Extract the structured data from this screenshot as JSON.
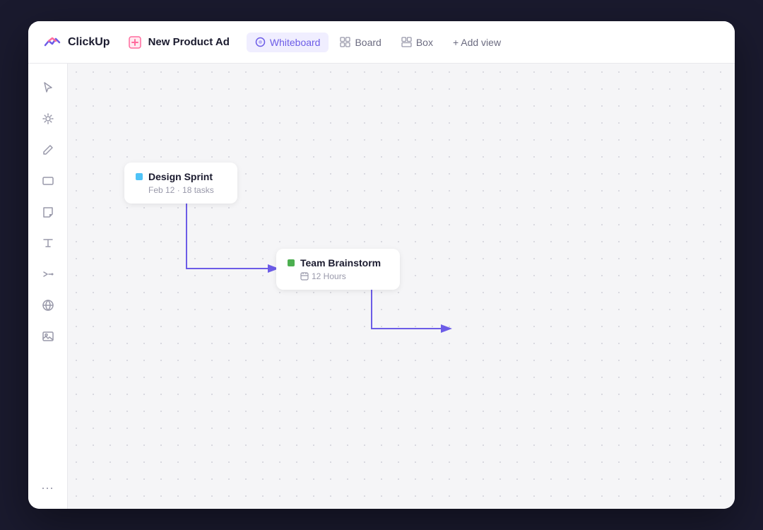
{
  "app": {
    "name": "ClickUp"
  },
  "topbar": {
    "project_title": "New Product Ad",
    "tabs": [
      {
        "id": "whiteboard",
        "label": "Whiteboard",
        "active": true,
        "icon": "⬡"
      },
      {
        "id": "board",
        "label": "Board",
        "active": false,
        "icon": "⊞"
      },
      {
        "id": "box",
        "label": "Box",
        "active": false,
        "icon": "⊟"
      }
    ],
    "add_view_label": "+ Add view"
  },
  "sidebar": {
    "icons": [
      {
        "id": "cursor",
        "name": "cursor-icon"
      },
      {
        "id": "magic",
        "name": "magic-icon"
      },
      {
        "id": "pen",
        "name": "pen-icon"
      },
      {
        "id": "rect",
        "name": "rectangle-icon"
      },
      {
        "id": "note",
        "name": "sticky-note-icon"
      },
      {
        "id": "text",
        "name": "text-icon"
      },
      {
        "id": "connector",
        "name": "connector-icon"
      },
      {
        "id": "globe",
        "name": "globe-icon"
      },
      {
        "id": "image",
        "name": "image-icon"
      }
    ],
    "more_label": "..."
  },
  "canvas": {
    "cards": [
      {
        "id": "design-sprint",
        "title": "Design Sprint",
        "meta": "Feb 12  ·  18 tasks",
        "color": "#4fc3f7"
      },
      {
        "id": "team-brainstorm",
        "title": "Team Brainstorm",
        "hours_label": "12 Hours",
        "color": "#4caf50"
      }
    ]
  }
}
